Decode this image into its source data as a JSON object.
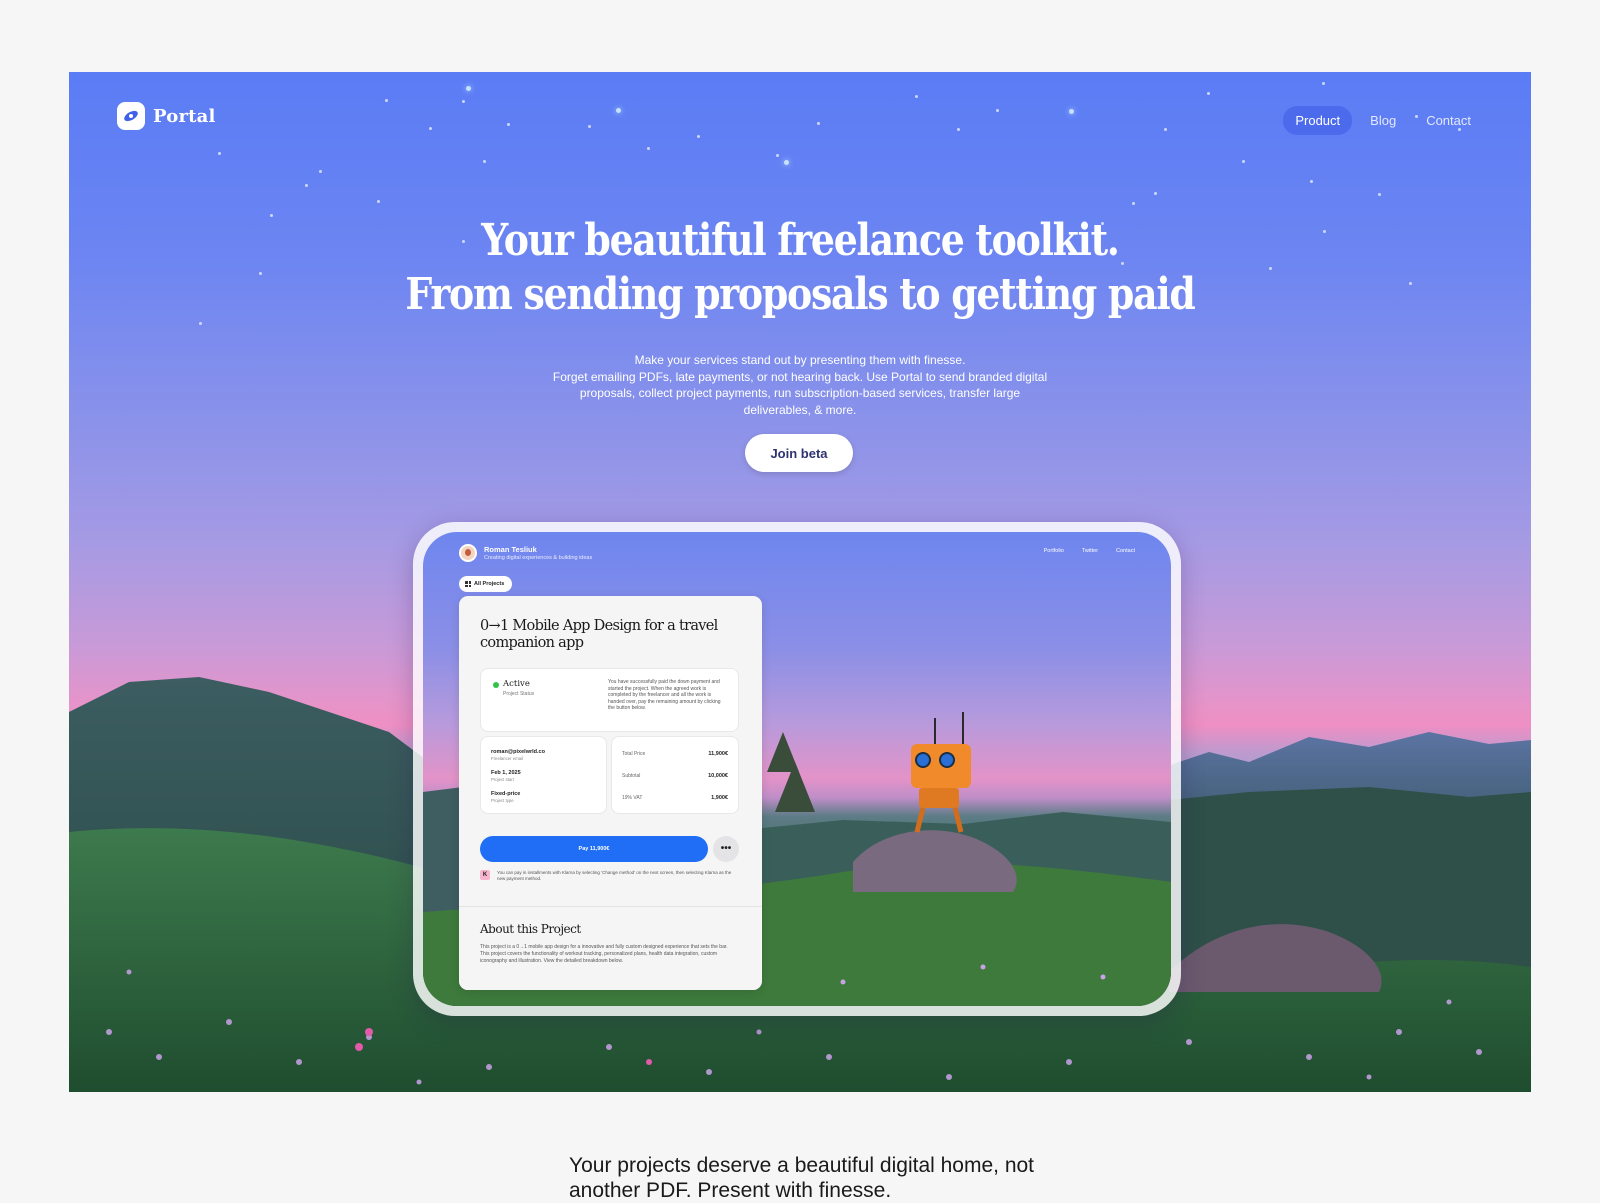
{
  "brand": {
    "name": "Portal"
  },
  "nav": {
    "items": [
      "Product",
      "Blog",
      "Contact"
    ],
    "active": "Product"
  },
  "hero": {
    "headline_line1": "Your beautiful freelance toolkit.",
    "headline_line2": "From sending proposals to getting paid",
    "sub_line1": "Make your services stand out by presenting them with finesse.",
    "sub_line2": "Forget emailing PDFs, late payments, or not hearing back. Use Portal to send branded digital proposals, collect project payments, run subscription-based services, transfer large deliverables, & more.",
    "cta": "Join beta"
  },
  "preview": {
    "profile_name": "Roman Tesliuk",
    "profile_tagline": "Creating digital experiences & building ideas",
    "nav": [
      "Portfolio",
      "Twitter",
      "Contact"
    ],
    "all_projects": "All Projects",
    "project_title": "0→1 Mobile App Design for a travel companion app",
    "status": "Active",
    "status_sub": "Project Status",
    "status_note": "You have successfully paid the down payment and started the project. When the agreed work is completed by the freelancer and all the work is handed over, pay the remaining amount by clicking the button below.",
    "freelancer_email": "roman@pixelwrld.co",
    "freelancer_email_label": "Freelancer email",
    "project_start": "Feb 1, 2025",
    "project_start_label": "Project start",
    "project_type": "Fixed-price",
    "project_type_label": "Project type",
    "total_label": "Total Price",
    "total_value": "11,900€",
    "subtotal_label": "Subtotal",
    "subtotal_value": "10,000€",
    "vat_label": "19% VAT",
    "vat_value": "1,900€",
    "pay_button": "Pay 11,900€",
    "more_button": "•••",
    "klarna_badge": "K",
    "klarna_note": "You can pay in installments with Klarna by selecting ‘Change method’ on the next screen, then selecting Klarna as the new payment method.",
    "about_title": "About this Project",
    "about_text": "This project is a 0→1 mobile app design for a innovative and fully custom designed experience that sets the bar. This project covers the functionality of workout tracking, personalized plans, health data integration, custom iconography and illustration. View the detailed breakdown below."
  },
  "below": {
    "text": "Your projects deserve a beautiful digital home, not another PDF. Present with finesse."
  }
}
